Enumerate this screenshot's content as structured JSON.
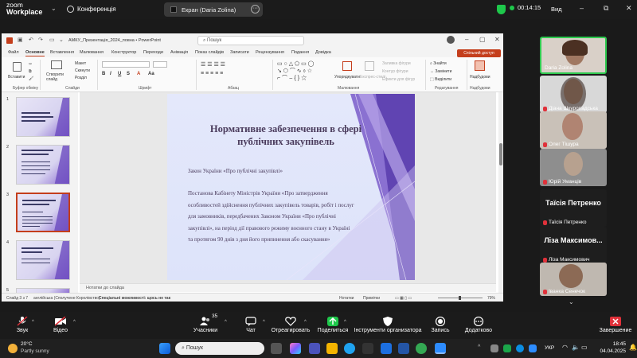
{
  "zoom": {
    "logo_line1": "zoom",
    "logo_line2": "Workplace",
    "conference": "Конференція",
    "screen_share": "Екран (Daria Zolina)",
    "timer": "00:14:15",
    "view": "Вид",
    "window_buttons": [
      "–",
      "⧉",
      "✕"
    ]
  },
  "ppt": {
    "filename": "АМКУ_Презентація_2024_повна  •  PowerPoint",
    "search_placeholder": "Пошук",
    "tabs": [
      "Файл",
      "Основне",
      "Вставлення",
      "Малювання",
      "Конструктор",
      "Переходи",
      "Анімація",
      "Показ слайдів",
      "Записати",
      "Рецензування",
      "Подання",
      "Довідка"
    ],
    "active_tab": "Основне",
    "share_button": "Спільний доступ",
    "ribbon": {
      "paste": "Вставити",
      "clipboard_label": "Буфер обміну",
      "new_slide": "Створити слайд",
      "layout": "Макет",
      "reset": "Скинути",
      "section": "Розділ",
      "slides_label": "Слайди",
      "font_label": "Шрифт",
      "paragraph_label": "Абзац",
      "arrange": "Упорядкувати",
      "quick_styles": "Експрес-стилі",
      "shape_fill": "Заливка фігури",
      "shape_outline": "Контур фігури",
      "shape_effects": "Ефекти для фігур",
      "drawing_label": "Малювання",
      "find": "Знайти",
      "replace": "Замінити",
      "select": "Виділити",
      "editing_label": "Редагування",
      "addins": "Надбудови",
      "addins_label": "Надбудови"
    },
    "slide_numbers": [
      "1",
      "2",
      "3",
      "4",
      "5"
    ],
    "slide": {
      "title": "Нормативне забезпечення в сфері публічних закупівель",
      "para1": "Закон України «Про публічні закупівлі»",
      "para2": "Постанова Кабінету Міністрів України «Про затвердження особливостей здійснення публічних закупівель товарів, робіт і послуг для замовників, передбачених Законом України «Про публічні закупівлі», на період дії правового режиму воєнного стану в Україні та протягом 90 днів з дня його припинення або скасування»"
    },
    "notes_placeholder": "Нотатки до слайда",
    "status": {
      "slide_count": "Слайд 3 з 7",
      "language": "англійська (Сполучене Королівство)",
      "accessibility": "Спеціальні можливості: щось не так",
      "notes": "Нотатки",
      "comments": "Примітки",
      "zoom": "79%"
    }
  },
  "participants": [
    {
      "name": "Daria Zolina",
      "muted": false,
      "video": true
    },
    {
      "name": "Діана Шкуропадська",
      "muted": true,
      "video": true
    },
    {
      "name": "Олег Тішура",
      "muted": true,
      "video": true
    },
    {
      "name": "Юрій Уманців",
      "muted": true,
      "video": true
    },
    {
      "name": "Таїсія Петренко",
      "big_name": "Таїсія Петренко",
      "muted": true,
      "video": false
    },
    {
      "name": "Ліза Максимович",
      "big_name": "Ліза Максимов...",
      "muted": true,
      "video": false
    },
    {
      "name": "Іванка Сенечок",
      "muted": true,
      "video": true
    }
  ],
  "toolbar": {
    "audio": "Звук",
    "video": "Відео",
    "participants": "Учасники",
    "participants_count": "35",
    "chat": "Чат",
    "react": "Отреагировать",
    "share": "Поделиться",
    "host_tools": "Інструменти организатора",
    "record": "Запись",
    "more": "Додатково",
    "end": "Завершение"
  },
  "taskbar": {
    "temp": "20°C",
    "weather": "Partly sunny",
    "search": "Пошук",
    "lang": "УКР",
    "time": "18:45",
    "date": "04.04.2025"
  },
  "colors": {
    "ppt_accent": "#c43e1c",
    "slide_title": "#4a3b5c",
    "slide_purple": "#6c4bbf",
    "muted_red": "#e0313a",
    "timer_green": "#1ec84b"
  }
}
